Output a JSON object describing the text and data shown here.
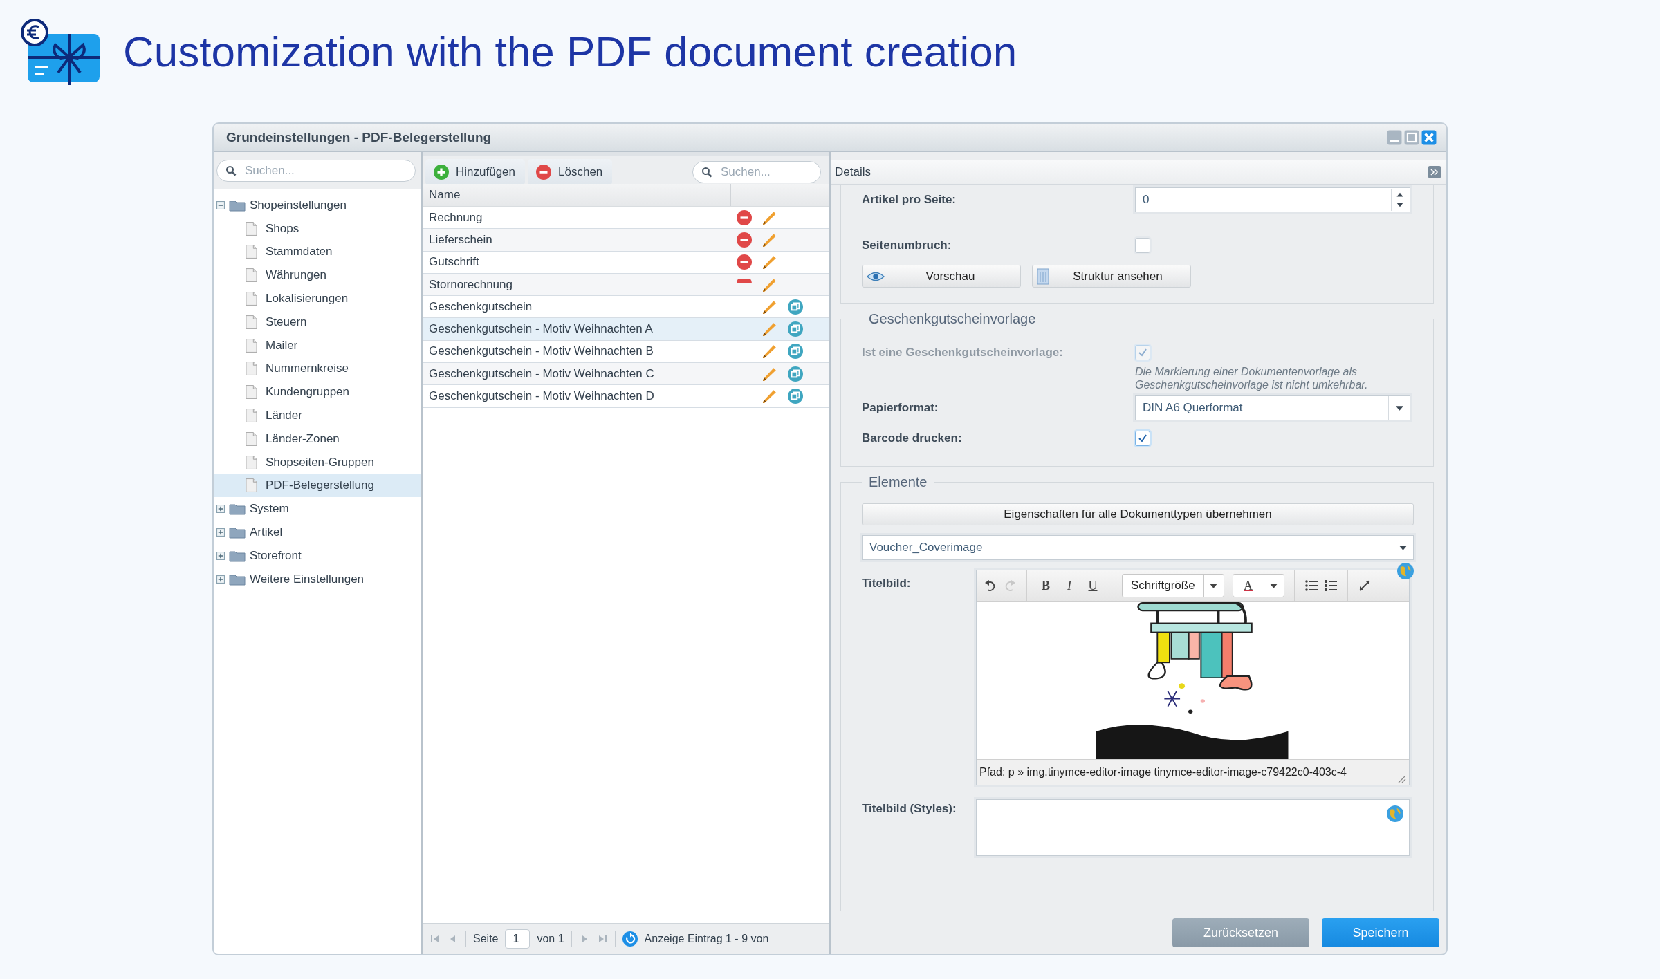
{
  "page_title": "Customization with the PDF document creation",
  "window": {
    "title": "Grundeinstellungen - PDF-Belegerstellung"
  },
  "tree": {
    "search_placeholder": "Suchen...",
    "items": [
      {
        "label": "Shopeinstellungen",
        "kind": "folder",
        "expanded": true,
        "selected": false,
        "children": [
          {
            "label": "Shops",
            "kind": "leaf",
            "selected": false
          },
          {
            "label": "Stammdaten",
            "kind": "leaf",
            "selected": false
          },
          {
            "label": "Währungen",
            "kind": "leaf",
            "selected": false
          },
          {
            "label": "Lokalisierungen",
            "kind": "leaf",
            "selected": false
          },
          {
            "label": "Steuern",
            "kind": "leaf",
            "selected": false
          },
          {
            "label": "Mailer",
            "kind": "leaf",
            "selected": false
          },
          {
            "label": "Nummernkreise",
            "kind": "leaf",
            "selected": false
          },
          {
            "label": "Kundengruppen",
            "kind": "leaf",
            "selected": false
          },
          {
            "label": "Länder",
            "kind": "leaf",
            "selected": false
          },
          {
            "label": "Länder-Zonen",
            "kind": "leaf",
            "selected": false
          },
          {
            "label": "Shopseiten-Gruppen",
            "kind": "leaf",
            "selected": false
          },
          {
            "label": "PDF-Belegerstellung",
            "kind": "leaf",
            "selected": true
          }
        ]
      },
      {
        "label": "System",
        "kind": "folder",
        "expanded": false,
        "selected": false
      },
      {
        "label": "Artikel",
        "kind": "folder",
        "expanded": false,
        "selected": false
      },
      {
        "label": "Storefront",
        "kind": "folder",
        "expanded": false,
        "selected": false
      },
      {
        "label": "Weitere Einstellungen",
        "kind": "folder",
        "expanded": false,
        "selected": false
      }
    ]
  },
  "list": {
    "toolbar": [
      {
        "label": "Hinzufügen",
        "kind": "add"
      },
      {
        "label": "Löschen",
        "kind": "delete"
      }
    ],
    "search_placeholder": "Suchen...",
    "columns": [
      "Name"
    ],
    "rows": [
      {
        "name": "Rechnung",
        "selected": false,
        "actions": [
          {
            "kind": "delete"
          },
          {
            "kind": "edit"
          }
        ]
      },
      {
        "name": "Lieferschein",
        "selected": false,
        "actions": [
          {
            "kind": "delete"
          },
          {
            "kind": "edit"
          }
        ]
      },
      {
        "name": "Gutschrift",
        "selected": false,
        "actions": [
          {
            "kind": "delete"
          },
          {
            "kind": "edit"
          }
        ]
      },
      {
        "name": "Stornorechnung",
        "selected": false,
        "actions": [
          {
            "kind": "delete_cut"
          },
          {
            "kind": "edit"
          }
        ]
      },
      {
        "name": "Geschenkgutschein",
        "selected": false,
        "actions": [
          {
            "kind": "edit"
          },
          {
            "kind": "copy"
          }
        ]
      },
      {
        "name": "Geschenkgutschein - Motiv Weihnachten A",
        "selected": true,
        "actions": [
          {
            "kind": "edit"
          },
          {
            "kind": "copy"
          }
        ]
      },
      {
        "name": "Geschenkgutschein - Motiv Weihnachten B",
        "selected": false,
        "actions": [
          {
            "kind": "edit"
          },
          {
            "kind": "copy"
          }
        ]
      },
      {
        "name": "Geschenkgutschein - Motiv Weihnachten C",
        "selected": false,
        "actions": [
          {
            "kind": "edit"
          },
          {
            "kind": "copy"
          }
        ]
      },
      {
        "name": "Geschenkgutschein - Motiv Weihnachten D",
        "selected": false,
        "actions": [
          {
            "kind": "edit"
          },
          {
            "kind": "copy"
          }
        ]
      }
    ],
    "pager": {
      "page_label": "Seite",
      "page": "1",
      "of": "von 1",
      "info": "Anzeige Eintrag 1 - 9 von"
    }
  },
  "details": {
    "title": "Details",
    "articles_per_page": {
      "label": "Artikel pro Seite:",
      "value": "0"
    },
    "page_break": {
      "label": "Seitenumbruch:",
      "checked": false
    },
    "buttons": [
      {
        "label": "Vorschau",
        "kind": "preview"
      },
      {
        "label": "Struktur ansehen",
        "kind": "structure"
      }
    ],
    "voucher_section": {
      "legend": "Geschenkgutscheinvorlage",
      "is_template": {
        "label": "Ist eine Geschenkgutscheinvorlage:",
        "checked": true,
        "disabled": true
      },
      "note": "Die Markierung einer Dokumentenvorlage als Geschenkgutscheinvorlage ist nicht umkehrbar.",
      "paper": {
        "label": "Papierformat:",
        "value": "DIN A6 Querformat"
      },
      "barcode": {
        "label": "Barcode drucken:",
        "checked": true,
        "disabled": false
      }
    },
    "elements_section": {
      "legend": "Elemente",
      "apply_button": "Eigenschaften für alle Dokumenttypen übernehmen",
      "element_select": "Voucher_Coverimage",
      "cover": {
        "label": "Titelbild:",
        "format_buttons": [
          "B",
          "I",
          "U"
        ],
        "font_size": "Schriftgröße",
        "color_letter": "A",
        "path": "Pfad: p » img.tinymce-editor-image tinymce-editor-image-c79422c0-403c-4"
      },
      "cover_styles": {
        "label": "Titelbild (Styles):"
      }
    }
  },
  "footer_buttons": [
    {
      "label": "Zurücksetzen",
      "kind": "secondary"
    },
    {
      "label": "Speichern",
      "kind": "primary"
    }
  ]
}
